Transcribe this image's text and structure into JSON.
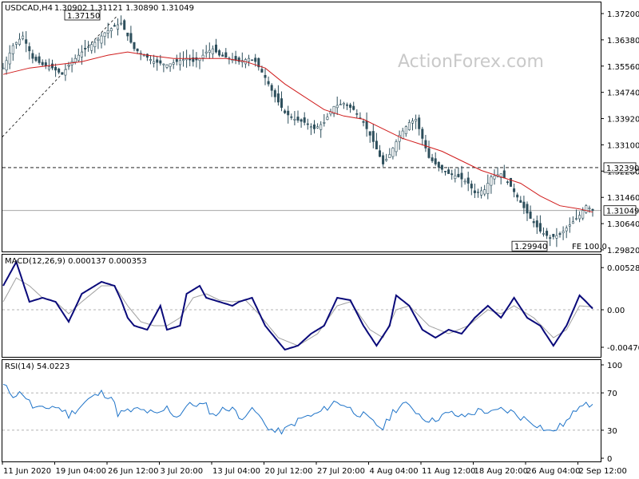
{
  "header": {
    "symbol": "USDCAD,H4",
    "ohlc": "1.30902 1.31121 1.30890 1.31049"
  },
  "watermark": "ActionForex.com",
  "colors": {
    "candle": "#2d4f5c",
    "ma": "#d01c1c",
    "macd": "#0a0a7a",
    "signal": "#a0a0a0",
    "rsi": "#1e73c8",
    "level": "#000000"
  },
  "chart_data": [
    {
      "type": "candlestick",
      "title": "USDCAD,H4",
      "y_ticks": [
        "1.37200",
        "1.36380",
        "1.35560",
        "1.34740",
        "1.33920",
        "1.33100",
        "1.32280",
        "1.31460",
        "1.30640",
        "1.29820"
      ],
      "ylim": [
        1.2982,
        1.372
      ],
      "ma_color": "#d01c1c",
      "price_path": [
        [
          0,
          1.355
        ],
        [
          3,
          1.362
        ],
        [
          6,
          1.365
        ],
        [
          9,
          1.358
        ],
        [
          12,
          1.356
        ],
        [
          15,
          1.355
        ],
        [
          18,
          1.353
        ],
        [
          20,
          1.356
        ],
        [
          22,
          1.358
        ],
        [
          25,
          1.361
        ],
        [
          28,
          1.363
        ],
        [
          31,
          1.366
        ],
        [
          34,
          1.368
        ],
        [
          36,
          1.369
        ],
        [
          38,
          1.365
        ],
        [
          40,
          1.361
        ],
        [
          43,
          1.359
        ],
        [
          46,
          1.357
        ],
        [
          50,
          1.356
        ],
        [
          53,
          1.357
        ],
        [
          56,
          1.358
        ],
        [
          58,
          1.357
        ],
        [
          60,
          1.358
        ],
        [
          62,
          1.36
        ],
        [
          64,
          1.361
        ],
        [
          66,
          1.359
        ],
        [
          69,
          1.358
        ],
        [
          72,
          1.357
        ],
        [
          75,
          1.358
        ],
        [
          77,
          1.357
        ],
        [
          80,
          1.352
        ],
        [
          83,
          1.346
        ],
        [
          86,
          1.341
        ],
        [
          89,
          1.339
        ],
        [
          92,
          1.338
        ],
        [
          95,
          1.336
        ],
        [
          98,
          1.338
        ],
        [
          101,
          1.343
        ],
        [
          104,
          1.344
        ],
        [
          107,
          1.342
        ],
        [
          110,
          1.338
        ],
        [
          113,
          1.332
        ],
        [
          116,
          1.325
        ],
        [
          118,
          1.328
        ],
        [
          121,
          1.334
        ],
        [
          124,
          1.338
        ],
        [
          126,
          1.339
        ],
        [
          128,
          1.333
        ],
        [
          130,
          1.327
        ],
        [
          133,
          1.324
        ],
        [
          136,
          1.322
        ],
        [
          139,
          1.321
        ],
        [
          142,
          1.319
        ],
        [
          144,
          1.316
        ],
        [
          147,
          1.317
        ],
        [
          149,
          1.321
        ],
        [
          152,
          1.322
        ],
        [
          155,
          1.318
        ],
        [
          158,
          1.313
        ],
        [
          161,
          1.308
        ],
        [
          164,
          1.304
        ],
        [
          167,
          1.302
        ],
        [
          170,
          1.303
        ],
        [
          173,
          1.306
        ],
        [
          176,
          1.309
        ],
        [
          178,
          1.312
        ],
        [
          180,
          1.3105
        ]
      ],
      "ma_path": [
        [
          0,
          1.353
        ],
        [
          8,
          1.355
        ],
        [
          16,
          1.356
        ],
        [
          24,
          1.357
        ],
        [
          32,
          1.359
        ],
        [
          38,
          1.36
        ],
        [
          44,
          1.359
        ],
        [
          52,
          1.358
        ],
        [
          60,
          1.358
        ],
        [
          68,
          1.358
        ],
        [
          74,
          1.357
        ],
        [
          80,
          1.355
        ],
        [
          86,
          1.35
        ],
        [
          92,
          1.346
        ],
        [
          98,
          1.342
        ],
        [
          104,
          1.34
        ],
        [
          110,
          1.339
        ],
        [
          116,
          1.336
        ],
        [
          122,
          1.333
        ],
        [
          128,
          1.331
        ],
        [
          134,
          1.329
        ],
        [
          140,
          1.326
        ],
        [
          146,
          1.323
        ],
        [
          152,
          1.321
        ],
        [
          158,
          1.319
        ],
        [
          164,
          1.315
        ],
        [
          170,
          1.312
        ],
        [
          176,
          1.311
        ],
        [
          180,
          1.31
        ]
      ],
      "levels": [
        {
          "label": "1.32390",
          "value": 1.3239,
          "style": "dashed"
        },
        {
          "label": "1.31049",
          "value": 1.31049,
          "style": "solid"
        }
      ],
      "annotations": [
        {
          "label": "1.37150",
          "value": 1.3715
        },
        {
          "label": "1.29940",
          "value": 1.2994
        },
        {
          "label": "FE 100.0",
          "value": 1.2985
        }
      ]
    },
    {
      "type": "line",
      "title": "MACD(12,26,9) 0.000137 0.000353",
      "y_ticks": [
        "0.00528",
        "0.00",
        "-0.004701"
      ],
      "ylim": [
        -0.0058,
        0.0062
      ],
      "series": [
        {
          "name": "MACD",
          "color": "#0a0a7a",
          "values": [
            [
              0,
              0.003
            ],
            [
              4,
              0.006
            ],
            [
              8,
              0.001
            ],
            [
              12,
              0.0015
            ],
            [
              16,
              0.001
            ],
            [
              20,
              -0.0015
            ],
            [
              24,
              0.002
            ],
            [
              30,
              0.0035
            ],
            [
              34,
              0.003
            ],
            [
              36,
              0.0012
            ],
            [
              38,
              -0.001
            ],
            [
              40,
              -0.002
            ],
            [
              44,
              -0.0025
            ],
            [
              48,
              0.0005
            ],
            [
              50,
              -0.0025
            ],
            [
              54,
              -0.002
            ],
            [
              56,
              0.002
            ],
            [
              60,
              0.003
            ],
            [
              62,
              0.0015
            ],
            [
              66,
              0.001
            ],
            [
              70,
              0.0005
            ],
            [
              72,
              0.001
            ],
            [
              76,
              0.0015
            ],
            [
              80,
              -0.002
            ],
            [
              86,
              -0.005
            ],
            [
              90,
              -0.0045
            ],
            [
              94,
              -0.003
            ],
            [
              98,
              -0.002
            ],
            [
              102,
              0.0015
            ],
            [
              106,
              0.0012
            ],
            [
              110,
              -0.002
            ],
            [
              114,
              -0.0045
            ],
            [
              118,
              -0.002
            ],
            [
              120,
              0.0018
            ],
            [
              124,
              0.0005
            ],
            [
              128,
              -0.0025
            ],
            [
              132,
              -0.0035
            ],
            [
              136,
              -0.0025
            ],
            [
              140,
              -0.003
            ],
            [
              144,
              -0.001
            ],
            [
              148,
              0.0005
            ],
            [
              152,
              -0.001
            ],
            [
              156,
              0.0015
            ],
            [
              160,
              -0.001
            ],
            [
              164,
              -0.002
            ],
            [
              168,
              -0.0045
            ],
            [
              172,
              -0.002
            ],
            [
              176,
              0.0018
            ],
            [
              178,
              0.001
            ],
            [
              180,
              0.000137
            ]
          ]
        },
        {
          "name": "Signal",
          "color": "#a0a0a0",
          "values": [
            [
              0,
              0.001
            ],
            [
              4,
              0.004
            ],
            [
              8,
              0.003
            ],
            [
              12,
              0.0015
            ],
            [
              16,
              0.001
            ],
            [
              20,
              -0.0005
            ],
            [
              24,
              0.001
            ],
            [
              30,
              0.003
            ],
            [
              34,
              0.003
            ],
            [
              38,
              0.0005
            ],
            [
              42,
              -0.0015
            ],
            [
              46,
              -0.002
            ],
            [
              50,
              -0.002
            ],
            [
              54,
              -0.001
            ],
            [
              58,
              0.0015
            ],
            [
              62,
              0.002
            ],
            [
              66,
              0.0012
            ],
            [
              70,
              0.001
            ],
            [
              74,
              0.0012
            ],
            [
              78,
              -0.0005
            ],
            [
              84,
              -0.0035
            ],
            [
              90,
              -0.0045
            ],
            [
              96,
              -0.003
            ],
            [
              102,
              0.0005
            ],
            [
              106,
              0.001
            ],
            [
              112,
              -0.0025
            ],
            [
              116,
              -0.0035
            ],
            [
              120,
              0.0
            ],
            [
              124,
              0.0005
            ],
            [
              130,
              -0.002
            ],
            [
              136,
              -0.003
            ],
            [
              142,
              -0.002
            ],
            [
              148,
              0.0
            ],
            [
              152,
              -0.0005
            ],
            [
              156,
              0.0005
            ],
            [
              162,
              -0.001
            ],
            [
              168,
              -0.0035
            ],
            [
              172,
              -0.0025
            ],
            [
              176,
              0.0005
            ],
            [
              180,
              0.000353
            ]
          ]
        }
      ]
    },
    {
      "type": "line",
      "title": "RSI(14) 54.0223",
      "y_ticks": [
        "100",
        "70",
        "30",
        "0"
      ],
      "ylim": [
        0,
        100
      ],
      "levels": [
        70,
        30
      ],
      "series": [
        {
          "name": "RSI",
          "color": "#1e73c8",
          "values": [
            [
              0,
              78
            ],
            [
              3,
              68
            ],
            [
              6,
              70
            ],
            [
              9,
              55
            ],
            [
              12,
              52
            ],
            [
              15,
              56
            ],
            [
              18,
              52
            ],
            [
              20,
              46
            ],
            [
              23,
              54
            ],
            [
              26,
              63
            ],
            [
              30,
              70
            ],
            [
              33,
              66
            ],
            [
              35,
              48
            ],
            [
              38,
              50
            ],
            [
              41,
              52
            ],
            [
              44,
              50
            ],
            [
              47,
              46
            ],
            [
              50,
              54
            ],
            [
              53,
              44
            ],
            [
              56,
              56
            ],
            [
              59,
              58
            ],
            [
              62,
              56
            ],
            [
              64,
              46
            ],
            [
              67,
              52
            ],
            [
              70,
              55
            ],
            [
              72,
              42
            ],
            [
              75,
              51
            ],
            [
              77,
              50
            ],
            [
              80,
              36
            ],
            [
              83,
              28
            ],
            [
              86,
              30
            ],
            [
              89,
              38
            ],
            [
              92,
              44
            ],
            [
              95,
              46
            ],
            [
              98,
              52
            ],
            [
              101,
              60
            ],
            [
              104,
              58
            ],
            [
              107,
              50
            ],
            [
              110,
              46
            ],
            [
              113,
              38
            ],
            [
              116,
              32
            ],
            [
              119,
              50
            ],
            [
              122,
              58
            ],
            [
              125,
              54
            ],
            [
              128,
              44
            ],
            [
              131,
              40
            ],
            [
              134,
              46
            ],
            [
              137,
              48
            ],
            [
              140,
              44
            ],
            [
              143,
              48
            ],
            [
              146,
              52
            ],
            [
              149,
              48
            ],
            [
              152,
              52
            ],
            [
              155,
              50
            ],
            [
              158,
              44
            ],
            [
              161,
              40
            ],
            [
              164,
              34
            ],
            [
              167,
              28
            ],
            [
              170,
              34
            ],
            [
              173,
              42
            ],
            [
              176,
              58
            ],
            [
              178,
              62
            ],
            [
              180,
              54
            ]
          ]
        }
      ]
    }
  ],
  "x_axis": {
    "labels": [
      "11 Jun 2020",
      "19 Jun 04:00",
      "26 Jun 12:00",
      "3 Jul 20:00",
      "13 Jul 04:00",
      "20 Jul 12:00",
      "27 Jul 20:00",
      "4 Aug 04:00",
      "11 Aug 12:00",
      "18 Aug 20:00",
      "26 Aug 04:00",
      "2 Sep 12:00"
    ]
  }
}
